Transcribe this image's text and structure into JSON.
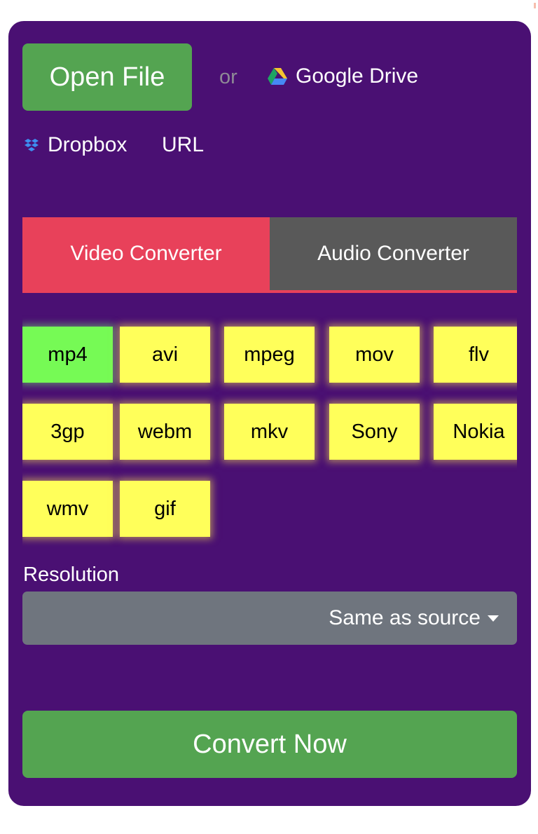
{
  "source": {
    "open_file_label": "Open File",
    "or_label": "or",
    "google_drive_label": "Google Drive",
    "dropbox_label": "Dropbox",
    "url_label": "URL"
  },
  "tabs": [
    {
      "label": "Video Converter",
      "active": true
    },
    {
      "label": "Audio Converter",
      "active": false
    }
  ],
  "formats": [
    {
      "label": "mp4",
      "selected": true
    },
    {
      "label": "avi",
      "selected": false
    },
    {
      "label": "mpeg",
      "selected": false
    },
    {
      "label": "mov",
      "selected": false
    },
    {
      "label": "flv",
      "selected": false
    },
    {
      "label": "3gp",
      "selected": false
    },
    {
      "label": "webm",
      "selected": false
    },
    {
      "label": "mkv",
      "selected": false
    },
    {
      "label": "Sony",
      "selected": false
    },
    {
      "label": "Nokia",
      "selected": false
    },
    {
      "label": "wmv",
      "selected": false
    },
    {
      "label": "gif",
      "selected": false
    }
  ],
  "resolution": {
    "label": "Resolution",
    "selected": "Same as source"
  },
  "convert_label": "Convert Now",
  "colors": {
    "panel": "#4a1073",
    "primary_button": "#54a451",
    "active_tab": "#e8415a",
    "inactive_tab": "#595959",
    "format_default": "#ffff5a",
    "format_selected": "#76fa55",
    "select_bg": "#6f757e"
  }
}
